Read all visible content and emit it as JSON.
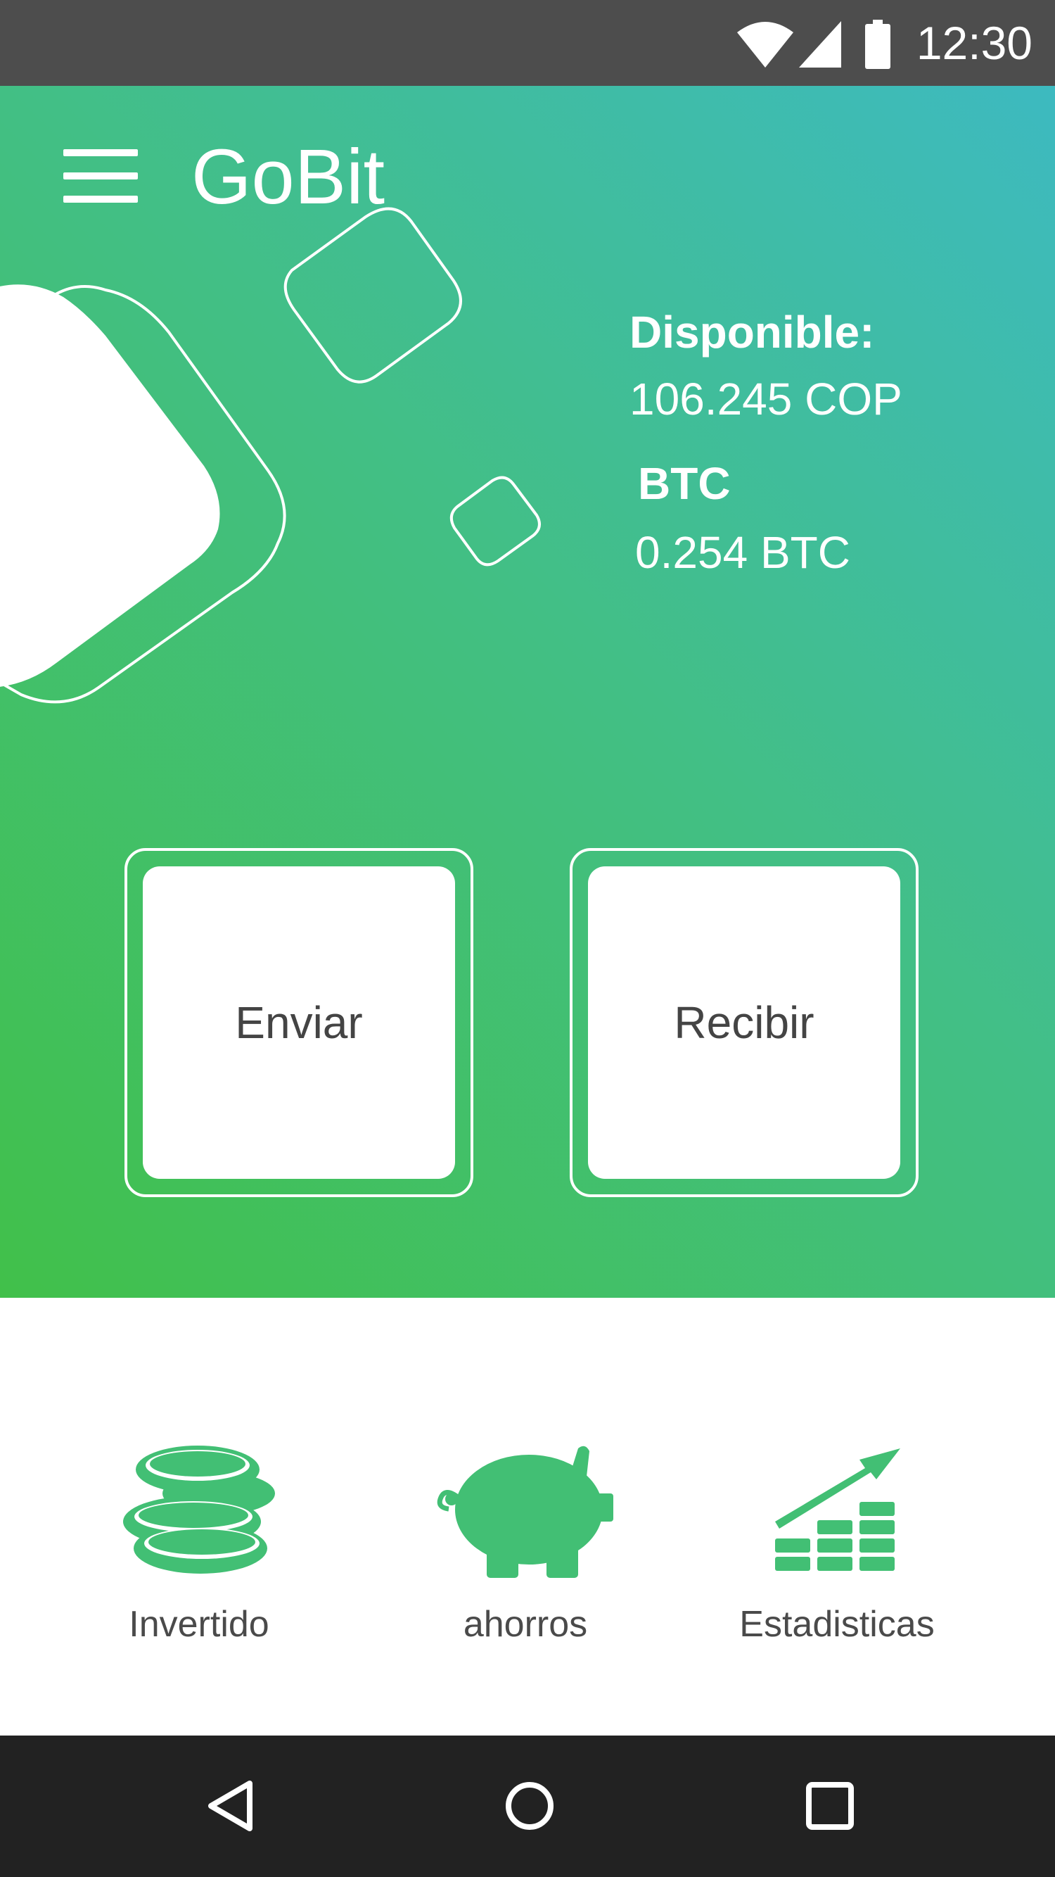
{
  "status_bar": {
    "time": "12:30",
    "icons": [
      "wifi-icon",
      "signal-icon",
      "battery-icon"
    ]
  },
  "header": {
    "app_title": "GoBit",
    "menu_icon": "hamburger-menu-icon"
  },
  "balance": {
    "available_label": "Disponible:",
    "available_value": "106.245 COP",
    "btc_label": "BTC",
    "btc_value": "0.254 BTC"
  },
  "actions": {
    "send_label": "Enviar",
    "receive_label": "Recibir"
  },
  "bottom_menu": {
    "items": [
      {
        "label": "Invertido",
        "icon": "coins-icon"
      },
      {
        "label": "ahorros",
        "icon": "piggy-bank-icon"
      },
      {
        "label": "Estadisticas",
        "icon": "statistics-icon"
      }
    ]
  },
  "nav_bar": {
    "icons": [
      "back-icon",
      "home-icon",
      "recents-icon"
    ]
  },
  "colors": {
    "gradient_start": "#41c04a",
    "gradient_mid": "#42bf86",
    "gradient_end": "#3dbac0",
    "accent_green": "#42bf74",
    "status_bar": "#4d4d4d",
    "nav_bar": "#222222"
  }
}
